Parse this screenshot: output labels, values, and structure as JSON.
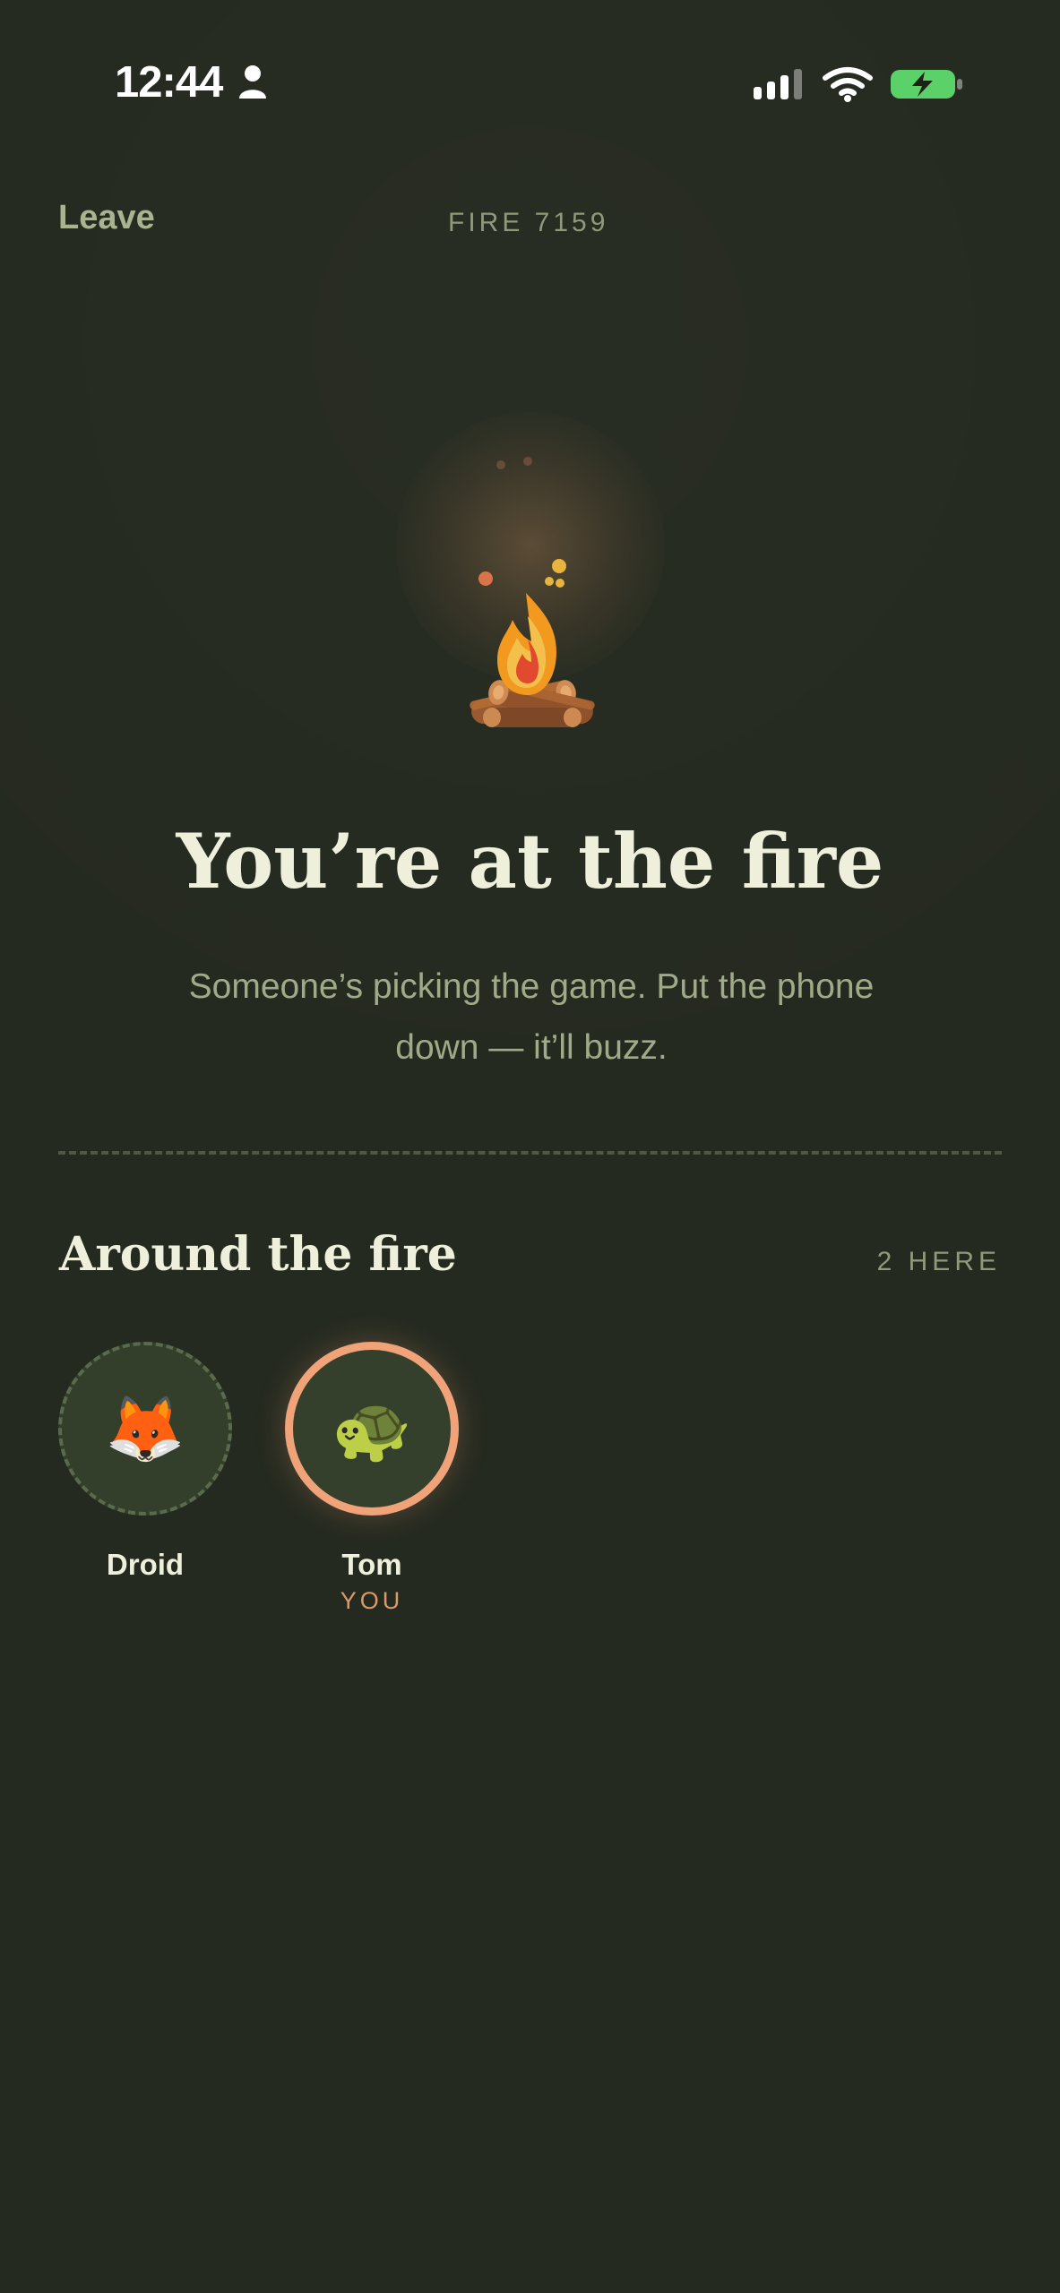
{
  "status_bar": {
    "time": "12:44",
    "person_icon": "person-icon",
    "signal_icon": "signal-icon",
    "wifi_icon": "wifi-icon",
    "battery_icon": "battery-charging-icon"
  },
  "header": {
    "leave_label": "Leave",
    "room_code": "FIRE 7159"
  },
  "hero": {
    "icon": "campfire-icon",
    "title": "You’re at the fire",
    "subtitle": "Someone’s picking the game. Put the phone down — it’ll buzz."
  },
  "participants_section": {
    "title": "Around the fire",
    "count_label": "2 HERE",
    "items": [
      {
        "name": "Droid",
        "emoji": "🦊",
        "icon": "fox-icon"
      },
      {
        "name": "Tom",
        "emoji": "🐢",
        "icon": "turtle-icon",
        "badge": "YOU"
      }
    ]
  },
  "colors": {
    "background": "#252a20",
    "text_primary": "#eef0dc",
    "text_secondary": "#9faa87",
    "muted_label": "#8e9a78",
    "accent_orange": "#f0a279",
    "battery_green": "#5bd16a"
  }
}
